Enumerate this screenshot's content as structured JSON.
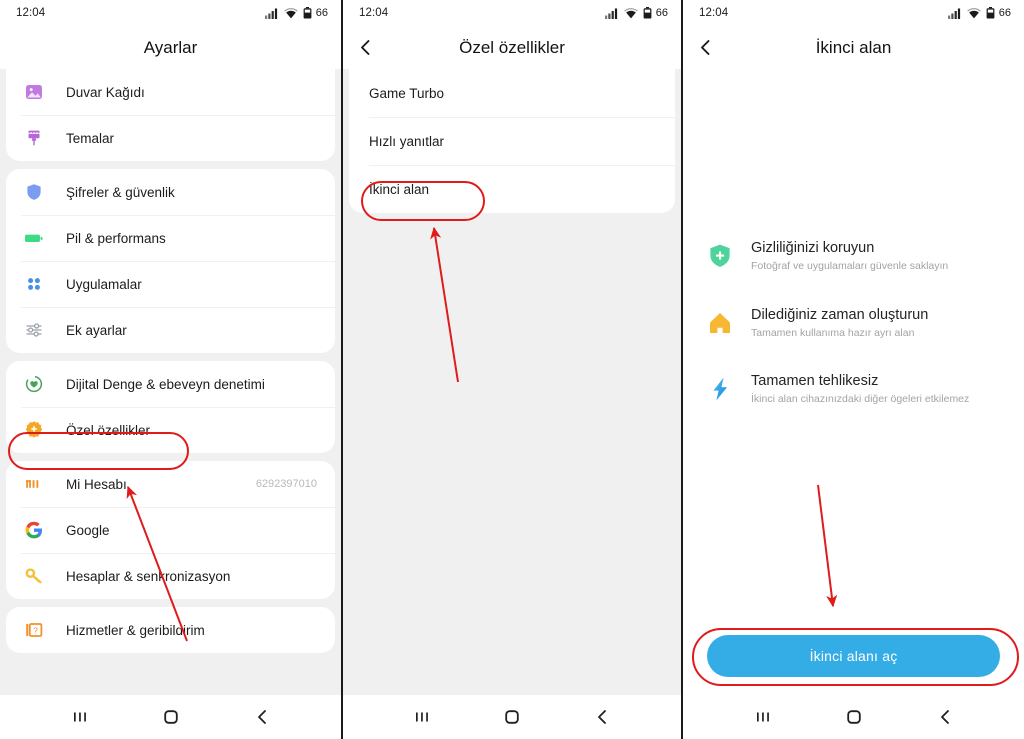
{
  "statusbar": {
    "time": "12:04",
    "battery_percent": "66",
    "icons": [
      "signal-icon",
      "wifi-icon",
      "battery-icon"
    ]
  },
  "navbar": {
    "recents_label": "III",
    "home_label": "O",
    "back_label": "<",
    "items": [
      "recents-button",
      "home-button",
      "back-button"
    ]
  },
  "screen1": {
    "title": "Ayarlar",
    "groups": [
      {
        "rows": [
          {
            "label": "Duvar Kağıdı",
            "icon": "wallpaper-icon",
            "color": "#c07ae0",
            "value": ""
          },
          {
            "label": "Temalar",
            "icon": "theme-brush-icon",
            "color": "#b768d8",
            "value": ""
          }
        ]
      },
      {
        "rows": [
          {
            "label": "Şifreler & güvenlik",
            "icon": "shield-icon",
            "color": "#7b9cf0",
            "value": ""
          },
          {
            "label": "Pil & performans",
            "icon": "battery-icon",
            "color": "#3ddc84",
            "value": ""
          },
          {
            "label": "Uygulamalar",
            "icon": "apps-grid-icon",
            "color": "#4a90e2",
            "value": ""
          },
          {
            "label": "Ek ayarlar",
            "icon": "sliders-icon",
            "color": "#9aa0a6",
            "value": ""
          }
        ]
      },
      {
        "rows": [
          {
            "label": "Dijital Denge & ebeveyn denetimi",
            "icon": "wellbeing-icon",
            "color": "#4aa35a",
            "value": ""
          },
          {
            "label": "Özel özellikler",
            "icon": "gear-icon",
            "color": "#f5a623",
            "value": "",
            "highlighted": true
          }
        ]
      },
      {
        "rows": [
          {
            "label": "Mi Hesabı",
            "icon": "mi-logo-icon",
            "color": "#f0922b",
            "value": "6292397010"
          },
          {
            "label": "Google",
            "icon": "google-g-icon",
            "color": "#4285f4",
            "value": ""
          },
          {
            "label": "Hesaplar & senkronizasyon",
            "icon": "key-icon",
            "color": "#f3c13a",
            "value": ""
          }
        ]
      },
      {
        "rows": [
          {
            "label": "Hizmetler & geribildirim",
            "icon": "services-feedback-icon",
            "color": "#f0922b",
            "value": ""
          }
        ]
      }
    ]
  },
  "screen2": {
    "title": "Özel özellikler",
    "back_icon": "chevron-left-icon",
    "rows": [
      {
        "label": "Game Turbo"
      },
      {
        "label": "Hızlı yanıtlar"
      },
      {
        "label": "İkinci alan",
        "highlighted": true
      }
    ]
  },
  "screen3": {
    "title": "İkinci alan",
    "back_icon": "chevron-left-icon",
    "features": [
      {
        "icon": "shield-plus-icon",
        "color": "#4ed39a",
        "title": "Gizliliğinizi koruyun",
        "subtitle": "Fotoğraf ve uygulamaları güvenle saklayın"
      },
      {
        "icon": "house-icon",
        "color": "#f7b733",
        "title": "Dilediğiniz zaman oluşturun",
        "subtitle": "Tamamen kullanıma hazır ayrı alan"
      },
      {
        "icon": "lightning-bolt-icon",
        "color": "#2196f3",
        "title": "Tamamen tehlikesiz",
        "subtitle": "İkinci alan cihazınızdaki diğer ögeleri etkilemez"
      }
    ],
    "primary_button": "İkinci alanı aç"
  },
  "annotations": {
    "color": "#e01b1b",
    "items": [
      {
        "type": "ellipse",
        "target": "Özel özellikler"
      },
      {
        "type": "arrow",
        "from": "Hizmetler & geribildirim",
        "to": "Özel özellikler"
      },
      {
        "type": "ellipse",
        "target": "İkinci alan"
      },
      {
        "type": "arrow",
        "to": "İkinci alan"
      },
      {
        "type": "arrow",
        "to": "İkinci alanı aç"
      },
      {
        "type": "ellipse",
        "target": "İkinci alanı aç"
      }
    ]
  }
}
